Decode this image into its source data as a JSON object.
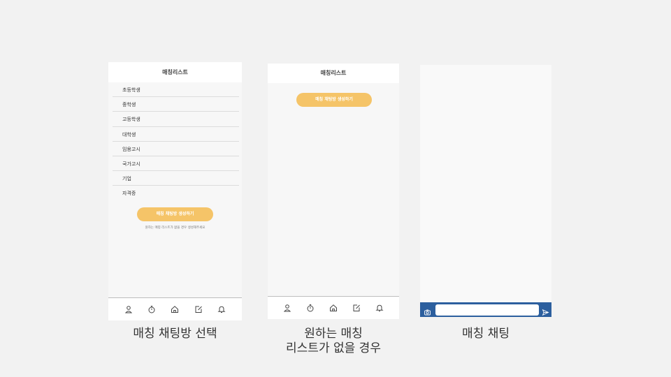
{
  "screen1": {
    "header_title": "매칭리스트",
    "items": [
      "초등학생",
      "중학생",
      "고등학생",
      "대학생",
      "임용고시",
      "국가고시",
      "기업",
      "자격증"
    ],
    "button_label": "매칭 채팅방 생성하기",
    "hint": "원하는 매칭 리스트가 없을 경우 생성해주세요",
    "tabs": [
      "person-icon",
      "timer-icon",
      "home-icon",
      "edit-icon",
      "bell-icon"
    ]
  },
  "screen2": {
    "header_title": "매칭리스트",
    "button_label": "매칭 채팅방 생성하기",
    "tabs": [
      "person-icon",
      "timer-icon",
      "home-icon",
      "edit-icon",
      "bell-icon"
    ]
  },
  "screen3": {
    "chat_input_value": "",
    "icons": [
      "camera-icon",
      "send-icon"
    ]
  },
  "captions": {
    "screen1": "매칭 채팅방 선택",
    "screen2_line1": "원하는 매칭",
    "screen2_line2": "리스트가 없을 경우",
    "screen3": "매칭 채팅"
  },
  "colors": {
    "accent_button": "#f5c468",
    "chat_bar": "#2c5f9e",
    "background": "#f2f2f2"
  }
}
